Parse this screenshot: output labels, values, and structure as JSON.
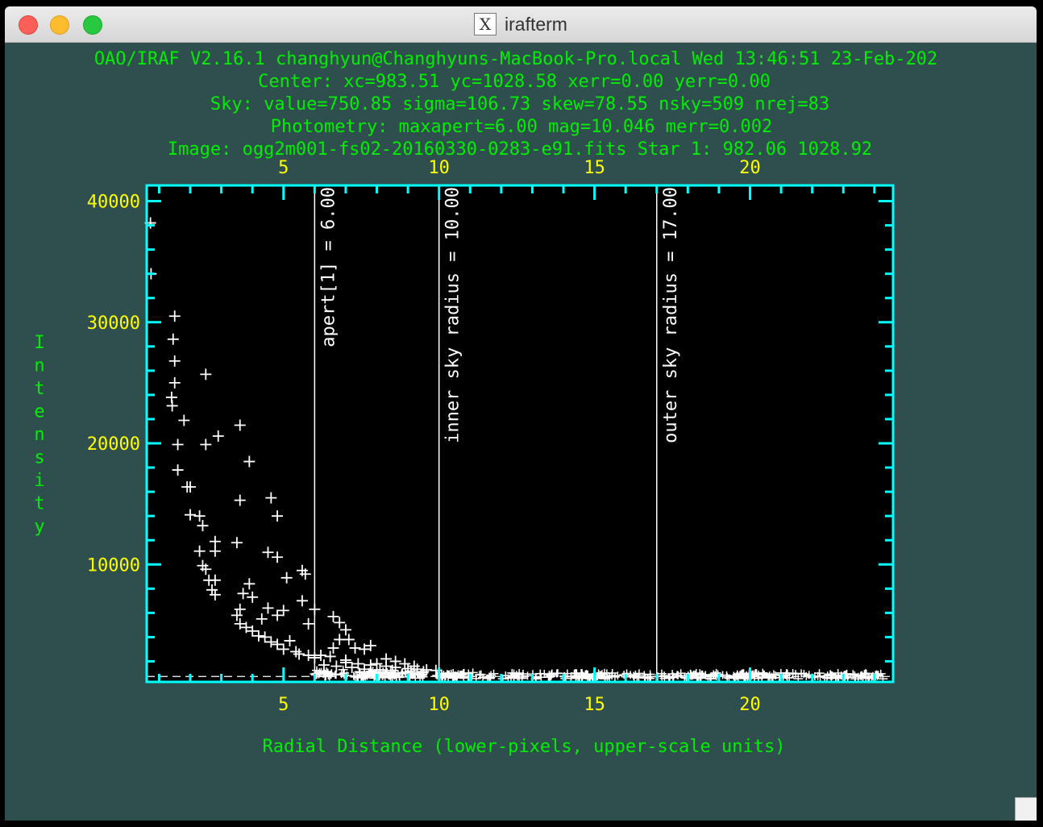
{
  "window": {
    "title": "irafterm",
    "app_icon": "x11-icon"
  },
  "header": {
    "line1": "OAO/IRAF V2.16.1 changhyun@Changhyuns-MacBook-Pro.local Wed 13:46:51 23-Feb-202",
    "line2": "Center: xc=983.51 yc=1028.58 xerr=0.00 yerr=0.00",
    "line3": "Sky: value=750.85 sigma=106.73 skew=78.55 nsky=509 nrej=83",
    "line4": "Photometry: maxapert=6.00  mag=10.046  merr=0.002",
    "line5": "Image: ogg2m001-fs02-20160330-0283-e91.fits  Star 1:  982.06 1028.92"
  },
  "colors": {
    "background": "#2f4f4f",
    "text": "#00ee00",
    "tick_label": "#ffff00",
    "frame": "#00ffff",
    "data": "#ffffff",
    "plot_bg": "#000000"
  },
  "chart_data": {
    "type": "scatter",
    "xlabel": "Radial Distance (lower-pixels, upper-scale units)",
    "ylabel": "Intensity",
    "xlim": [
      0.6,
      24.6
    ],
    "ylim": [
      300,
      41300
    ],
    "xticks": [
      5,
      10,
      15,
      20
    ],
    "xtick_labels": [
      "5",
      "10",
      "15",
      "20"
    ],
    "yticks": [
      10000,
      20000,
      30000,
      40000
    ],
    "ytick_labels": [
      "10000",
      "20000",
      "30000",
      "40000"
    ],
    "sky_level": 750.85,
    "marker": "+",
    "vlines": [
      {
        "x": 6.0,
        "label": "apert[1] = 6.00"
      },
      {
        "x": 10.0,
        "label": "inner sky radius = 10.00"
      },
      {
        "x": 17.0,
        "label": "outer sky radius = 17.00"
      }
    ],
    "points": [
      [
        0.72,
        38200
      ],
      [
        0.74,
        34000
      ],
      [
        1.5,
        30500
      ],
      [
        1.45,
        28600
      ],
      [
        1.5,
        26800
      ],
      [
        1.5,
        25000
      ],
      [
        1.4,
        23800
      ],
      [
        1.42,
        23100
      ],
      [
        2.5,
        25700
      ],
      [
        1.8,
        21900
      ],
      [
        1.6,
        19900
      ],
      [
        1.6,
        17800
      ],
      [
        1.9,
        16400
      ],
      [
        2.0,
        16400
      ],
      [
        2.0,
        14100
      ],
      [
        2.3,
        14000
      ],
      [
        2.4,
        13200
      ],
      [
        2.8,
        11900
      ],
      [
        2.8,
        11100
      ],
      [
        2.3,
        11100
      ],
      [
        2.4,
        9900
      ],
      [
        2.5,
        9600
      ],
      [
        2.6,
        8700
      ],
      [
        2.8,
        8700
      ],
      [
        2.7,
        7900
      ],
      [
        2.8,
        7500
      ],
      [
        2.5,
        19900
      ],
      [
        2.9,
        20600
      ],
      [
        3.6,
        21500
      ],
      [
        3.9,
        18500
      ],
      [
        3.6,
        15300
      ],
      [
        3.5,
        11800
      ],
      [
        4.6,
        15500
      ],
      [
        4.8,
        14000
      ],
      [
        4.5,
        11000
      ],
      [
        4.8,
        10600
      ],
      [
        5.1,
        8900
      ],
      [
        5.6,
        9500
      ],
      [
        5.7,
        9200
      ],
      [
        5.6,
        7000
      ],
      [
        6.0,
        6300
      ],
      [
        5.8,
        5100
      ],
      [
        3.7,
        7600
      ],
      [
        3.9,
        8400
      ],
      [
        4.0,
        7300
      ],
      [
        3.6,
        6300
      ],
      [
        3.5,
        5800
      ],
      [
        3.6,
        5100
      ],
      [
        3.8,
        4800
      ],
      [
        4.0,
        4500
      ],
      [
        4.3,
        5500
      ],
      [
        4.5,
        6400
      ],
      [
        4.8,
        5800
      ],
      [
        5.0,
        6200
      ],
      [
        4.4,
        4000
      ],
      [
        4.2,
        4100
      ],
      [
        4.6,
        3600
      ],
      [
        4.8,
        3400
      ],
      [
        5.2,
        3700
      ],
      [
        5.0,
        3000
      ],
      [
        5.4,
        2800
      ],
      [
        5.5,
        2600
      ],
      [
        5.8,
        2500
      ],
      [
        6.2,
        2500
      ],
      [
        6.0,
        2300
      ],
      [
        6.5,
        2400
      ],
      [
        7.0,
        2100
      ],
      [
        6.6,
        3100
      ],
      [
        6.8,
        3800
      ],
      [
        7.1,
        3800
      ],
      [
        7.3,
        3100
      ],
      [
        7.6,
        3000
      ],
      [
        7.8,
        3300
      ],
      [
        6.6,
        5700
      ],
      [
        6.8,
        5200
      ],
      [
        7.0,
        4600
      ],
      [
        7.0,
        1900
      ],
      [
        7.4,
        1800
      ],
      [
        7.8,
        1700
      ],
      [
        8.0,
        1800
      ],
      [
        8.3,
        1600
      ],
      [
        8.6,
        1500
      ],
      [
        9.0,
        1400
      ],
      [
        9.3,
        1350
      ],
      [
        9.6,
        1300
      ],
      [
        9.9,
        1250
      ],
      [
        8.3,
        2200
      ],
      [
        8.6,
        2000
      ],
      [
        8.9,
        1800
      ],
      [
        9.2,
        1600
      ],
      [
        6.3,
        1700
      ],
      [
        6.7,
        1600
      ],
      [
        7.2,
        1500
      ],
      [
        7.6,
        1350
      ],
      [
        8.1,
        1300
      ],
      [
        8.5,
        1250
      ],
      [
        9.1,
        1200
      ],
      [
        9.5,
        1150
      ]
    ]
  }
}
